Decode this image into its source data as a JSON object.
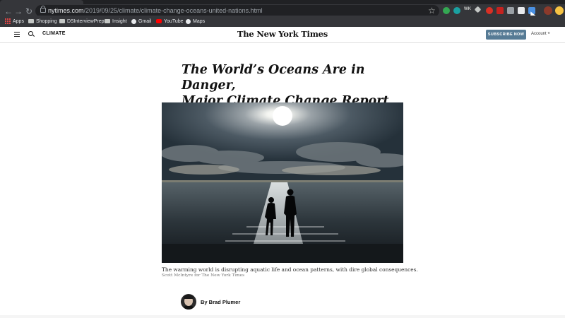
{
  "browser": {
    "url_host": "nytimes.com",
    "url_path": "/2019/09/25/climate/climate-change-oceans-united-nations.html",
    "extensions": [
      {
        "name": "green-extension-icon",
        "color": "#34a853"
      },
      {
        "name": "teal-extension-icon",
        "color": "#1aa1a1"
      },
      {
        "name": "wk-extension-icon",
        "color": "#c4c7c5"
      },
      {
        "name": "tag-extension-icon",
        "color": "#c4c7c5"
      },
      {
        "name": "red-extension-icon",
        "color": "#d93025"
      },
      {
        "name": "abp-extension-icon",
        "color": "#c5221f"
      },
      {
        "name": "gray-extension-icon",
        "color": "#9aa0a6"
      },
      {
        "name": "pocket-extension-icon",
        "color": "#e8eaed"
      },
      {
        "name": "dark-extension-icon",
        "color": "#202124"
      },
      {
        "name": "blue-extension-icon",
        "color": "#4a90e2"
      }
    ],
    "ext_text": "WK"
  },
  "bookmarks": {
    "apps": "Apps",
    "shopping": "Shopping",
    "dsinterview": "DSInterviewPrep",
    "insight": "Insight",
    "gmail": "Gmail",
    "youtube": "YouTube",
    "maps": "Maps"
  },
  "header": {
    "section": "CLIMATE",
    "logo": "The New York Times",
    "subscribe": "SUBSCRIBE NOW",
    "account": "Account ˅"
  },
  "article": {
    "headline_line1": "The World’s Oceans Are in Danger,",
    "headline_line2": "Major Climate Change Report Warns",
    "caption": "The warming world is disrupting aquatic life and ocean patterns, with dire global consequences.",
    "credit": "Scott McIntyre for The New York Times",
    "byline_prefix": "By ",
    "author": "Brad Plumer"
  },
  "colors": {
    "chrome": "#35363a",
    "subscribe": "#567b95",
    "text": "#121212"
  }
}
